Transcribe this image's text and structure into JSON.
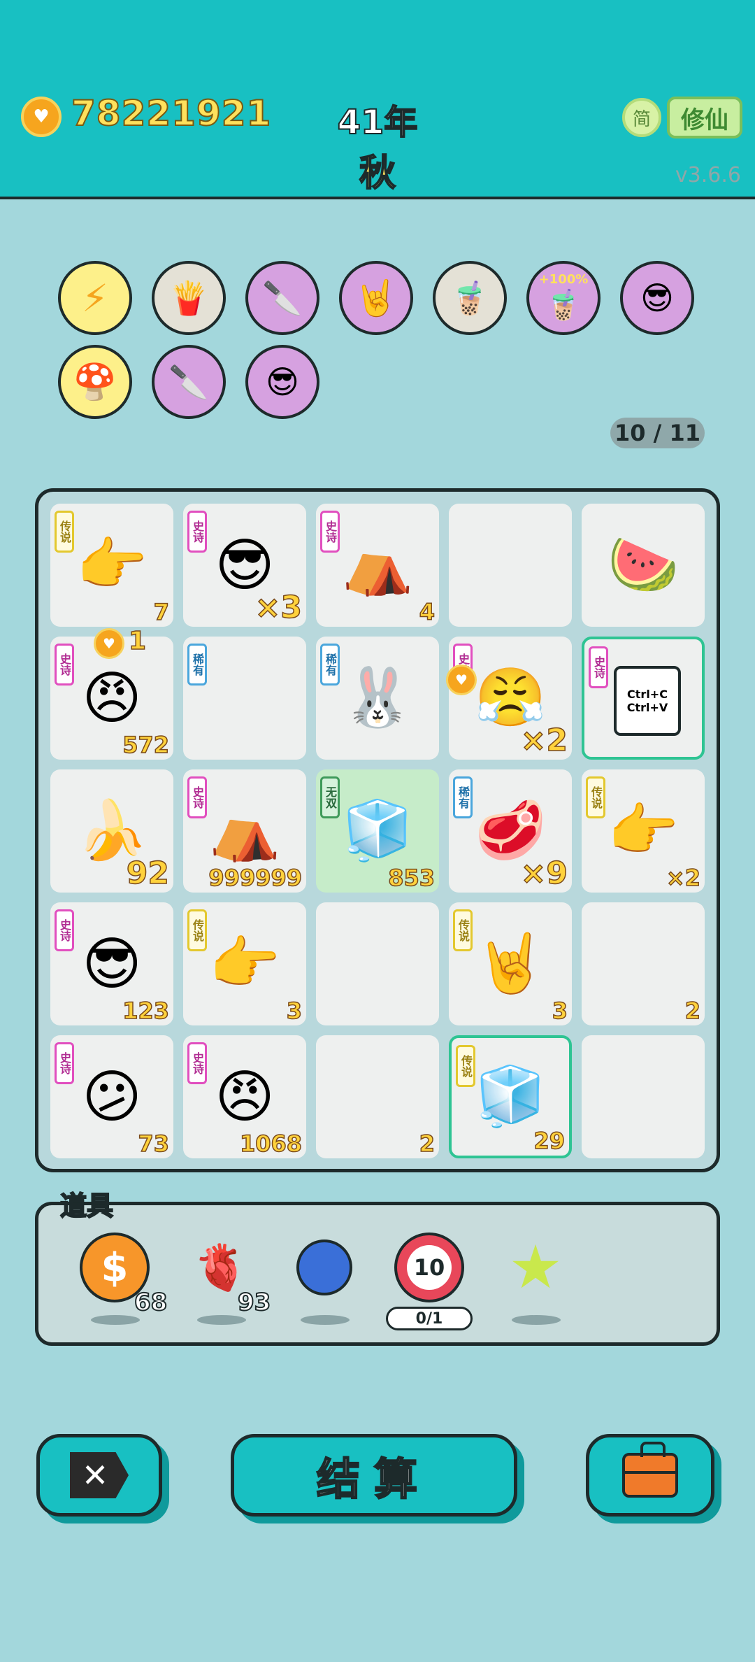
{
  "header": {
    "coins": "78221921",
    "year": "41年",
    "season": "秋",
    "lang_button": "简",
    "mode_button": "修仙",
    "version": "v3.6.6"
  },
  "relics": {
    "count": "10 / 11",
    "items": [
      {
        "icon": "lightning-icon"
      },
      {
        "icon": "fries-icon"
      },
      {
        "icon": "cleaver-icon"
      },
      {
        "icon": "rock-hand-icon"
      },
      {
        "icon": "milk-tea-icon"
      },
      {
        "icon": "milk-tea-plus-icon",
        "label": "+100%"
      },
      {
        "icon": "multiplier-man-icon"
      },
      {
        "icon": "mushroom-cloud-icon"
      },
      {
        "icon": "cleaver-icon"
      },
      {
        "icon": "multiplier-man-icon"
      }
    ]
  },
  "board": {
    "cells": [
      {
        "tag": "传说",
        "icon": "pointing-hand-icon",
        "num": "7"
      },
      {
        "tag": "史诗",
        "icon": "green-hair-man-icon",
        "num": "×3"
      },
      {
        "tag": "史诗",
        "icon": "rabbit-tent-icon",
        "num": "4"
      },
      {
        "tag": "",
        "icon": "",
        "num": ""
      },
      {
        "tag": "",
        "icon": "watermelon-icon",
        "num": ""
      },
      {
        "tag": "史诗",
        "icon": "grumpy-man-icon",
        "num": "572",
        "badge": "1"
      },
      {
        "tag": "稀有",
        "icon": "",
        "num": ""
      },
      {
        "tag": "稀有",
        "icon": "rabbit-icon",
        "num": ""
      },
      {
        "tag": "史诗",
        "icon": "meat-man-icon",
        "num": "×2"
      },
      {
        "tag": "史诗",
        "icon": "ctrl-cv-icon",
        "num": "",
        "text": "Ctrl+C Ctrl+V"
      },
      {
        "tag": "",
        "icon": "banana-icon",
        "num": "92"
      },
      {
        "tag": "史诗",
        "icon": "rabbit-tent-icon",
        "num": "999999"
      },
      {
        "tag": "无双",
        "icon": "fridge-icon",
        "num": "853"
      },
      {
        "tag": "稀有",
        "icon": "steak-icon",
        "num": "×9"
      },
      {
        "tag": "传说",
        "icon": "pointing-hand-icon",
        "num": "×2"
      },
      {
        "tag": "史诗",
        "icon": "green-hair-man-icon",
        "num": "123"
      },
      {
        "tag": "传说",
        "icon": "pointing-hand-icon",
        "num": "3"
      },
      {
        "tag": "",
        "icon": "",
        "num": ""
      },
      {
        "tag": "传说",
        "icon": "rock-hand-icon",
        "num": "3"
      },
      {
        "tag": "",
        "icon": "",
        "num": "2"
      },
      {
        "tag": "史诗",
        "icon": "question-man-icon",
        "num": "73"
      },
      {
        "tag": "史诗",
        "icon": "grumpy-man-icon",
        "num": "1068"
      },
      {
        "tag": "",
        "icon": "",
        "num": "2"
      },
      {
        "tag": "传说",
        "icon": "fridge-icon",
        "num": "29"
      },
      {
        "tag": "",
        "icon": "",
        "num": ""
      }
    ]
  },
  "props": {
    "title": "道具",
    "items": [
      {
        "icon": "dollar-coin-icon",
        "num": "68"
      },
      {
        "icon": "liver-icon",
        "num": "93"
      },
      {
        "icon": "blueberry-icon",
        "num": ""
      },
      {
        "icon": "target-10-icon",
        "label": "10",
        "pill": "0/1"
      },
      {
        "icon": "star-icon",
        "num": ""
      }
    ]
  },
  "buttons": {
    "exit_label": "✕",
    "settle_label": "结算"
  },
  "colors": {
    "header_bg": "#18c0c2",
    "page_bg": "#a3d7dc",
    "epic": "#e14fbf",
    "legend": "#e3c82e",
    "rare": "#4aa6dc",
    "gold_text": "#ffd23c"
  }
}
